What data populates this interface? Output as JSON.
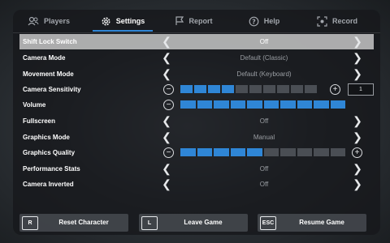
{
  "tabs": [
    {
      "label": "Players",
      "icon": "players-icon",
      "active": false
    },
    {
      "label": "Settings",
      "icon": "gear-icon",
      "active": true
    },
    {
      "label": "Report",
      "icon": "flag-icon",
      "active": false
    },
    {
      "label": "Help",
      "icon": "help-icon",
      "active": false
    },
    {
      "label": "Record",
      "icon": "record-icon",
      "active": false
    }
  ],
  "settings": [
    {
      "label": "Shift Lock Switch",
      "value": "Off"
    },
    {
      "label": "Camera Mode",
      "value": "Default (Classic)"
    },
    {
      "label": "Movement Mode",
      "value": "Default (Keyboard)"
    },
    {
      "label": "Camera Sensitivity",
      "slider_level": 0.4,
      "value": "1"
    },
    {
      "label": "Volume",
      "slider_level": 1.0
    },
    {
      "label": "Fullscreen",
      "value": "Off"
    },
    {
      "label": "Graphics Mode",
      "value": "Manual"
    },
    {
      "label": "Graphics Quality",
      "slider_level": 0.5
    },
    {
      "label": "Performance Stats",
      "value": "Off"
    },
    {
      "label": "Camera Inverted",
      "value": "Off"
    }
  ],
  "bottom_buttons": [
    {
      "key": "R",
      "label": "Reset Character"
    },
    {
      "key": "L",
      "label": "Leave Game"
    },
    {
      "key": "ESC",
      "label": "Resume Game"
    }
  ],
  "colors": {
    "accent": "#2f86d6",
    "selected_row": "#cdcdcd",
    "panel": "#16181c"
  }
}
